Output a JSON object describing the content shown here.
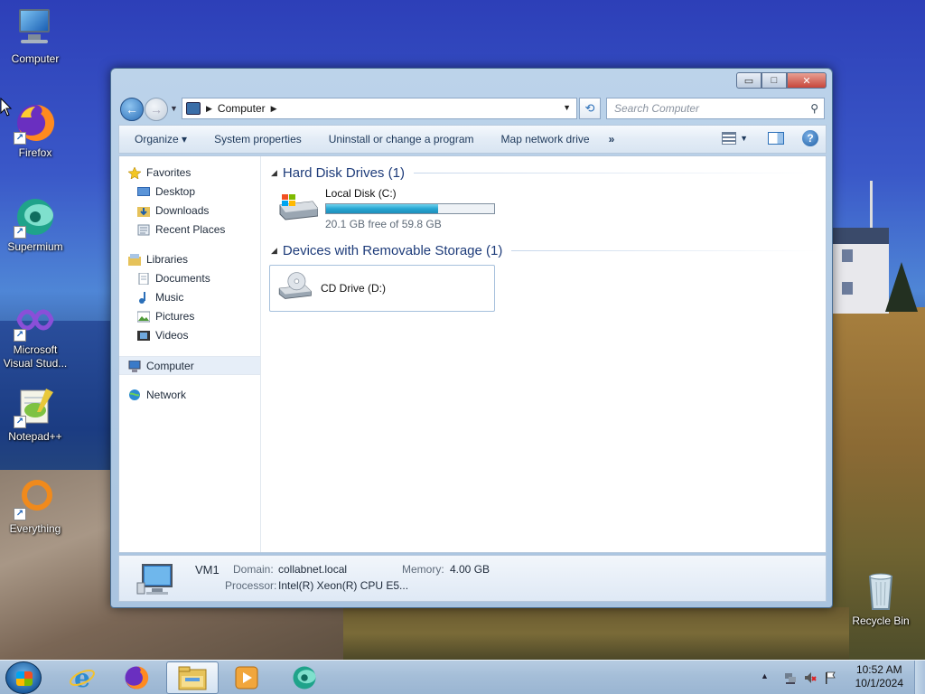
{
  "desktop": {
    "icons": [
      {
        "label": "Computer"
      },
      {
        "label": "Firefox"
      },
      {
        "label": "Supermium"
      },
      {
        "label": "Microsoft Visual Stud..."
      },
      {
        "label": "Notepad++"
      },
      {
        "label": "Everything"
      },
      {
        "label": "Recycle Bin"
      }
    ]
  },
  "window": {
    "controls": {
      "minimize": "▭",
      "maximize": "□",
      "close": "✕"
    },
    "address": {
      "crumb": "Computer"
    },
    "search": {
      "placeholder": "Search Computer"
    },
    "toolbar": {
      "organize": "Organize ▾",
      "system_properties": "System properties",
      "uninstall": "Uninstall or change a program",
      "map_drive": "Map network drive",
      "more": "»",
      "help": "?"
    },
    "nav": {
      "favorites": "Favorites",
      "desktop": "Desktop",
      "downloads": "Downloads",
      "recent_places": "Recent Places",
      "libraries": "Libraries",
      "documents": "Documents",
      "music": "Music",
      "pictures": "Pictures",
      "videos": "Videos",
      "computer": "Computer",
      "network": "Network"
    },
    "groups": {
      "hdd_header": "Hard Disk Drives (1)",
      "removable_header": "Devices with Removable Storage (1)"
    },
    "drives": {
      "c_name": "Local Disk (C:)",
      "c_free_text": "20.1 GB free of 59.8 GB",
      "c_used_fraction": 0.664,
      "d_name": "CD Drive (D:)"
    },
    "details": {
      "name": "VM1",
      "domain_label": "Domain:",
      "domain_value": "collabnet.local",
      "memory_label": "Memory:",
      "memory_value": "4.00 GB",
      "processor_label": "Processor:",
      "processor_value": "Intel(R) Xeon(R) CPU E5..."
    }
  },
  "taskbar": {
    "clock_time": "10:52 AM",
    "clock_date": "10/1/2024",
    "tray_up": "▲"
  },
  "colors": {
    "accent": "#1e3c7a",
    "progress": "#27a6d2"
  }
}
